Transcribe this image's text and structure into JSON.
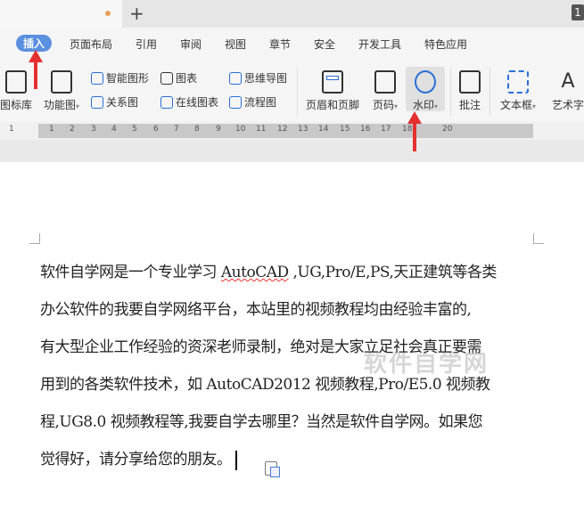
{
  "tabbar": {
    "new_tab": "+",
    "window_count": "1"
  },
  "menu": {
    "items": [
      "插入",
      "页面布局",
      "引用",
      "审阅",
      "视图",
      "章节",
      "安全",
      "开发工具",
      "特色应用"
    ]
  },
  "ribbon": {
    "icon_library": "图标库",
    "function_chart": "功能图",
    "smart_shape": "智能图形",
    "chart": "图表",
    "mind_map": "思维导图",
    "relation_chart": "关系图",
    "online_chart": "在线图表",
    "flowchart": "流程图",
    "header_footer": "页眉和页脚",
    "page_number": "页码",
    "watermark": "水印",
    "comment": "批注",
    "text_box": "文本框",
    "art_text": "艺术字"
  },
  "ruler": {
    "ticks": [
      "1",
      "1",
      "2",
      "3",
      "4",
      "5",
      "6",
      "7",
      "8",
      "9",
      "10",
      "11",
      "12",
      "13",
      "14",
      "15",
      "16",
      "17",
      "18",
      "20"
    ]
  },
  "document": {
    "lines": [
      {
        "pre": "软件自学网是一个专业学习 ",
        "err": "AutoCAD",
        "post": " ,UG,Pro/E,PS,天正建筑等各类"
      },
      "办公软件的我要自学网络平台，本站里的视频教程均由经验丰富的,",
      "有大型企业工作经验的资深老师录制，绝对是大家立足社会真正要需",
      "用到的各类软件技术，如 AutoCAD2012 视频教程,Pro/E5.0 视频教",
      "程,UG8.0 视频教程等,我要自学去哪里？当然是软件自学网。如果您",
      "觉得好，请分享给您的朋友。"
    ],
    "watermark_text": "软件自学网"
  }
}
